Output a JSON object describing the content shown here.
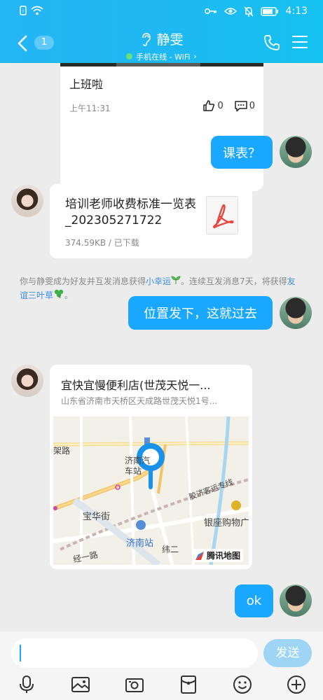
{
  "status_bar": {
    "time": "4:13"
  },
  "header": {
    "unread_count": "1",
    "contact_name": "静雯",
    "status": "手机在线 - WiFi",
    "status_chevron": "›"
  },
  "messages": {
    "post": {
      "text": "上班啦",
      "time": "上午11:31",
      "likes": "0",
      "comments": "0"
    },
    "msg1": {
      "text": "课表？"
    },
    "file": {
      "name": "培训老师收费标准一览表_202305271722",
      "meta": "374.59KB / 已下载"
    },
    "system": {
      "part1": "你与静雯成为好友并互发消息获得",
      "link1": "小幸运",
      "part2": "。连续互发消息7天，将获得",
      "link2": "友谊三叶草"
    },
    "msg2": {
      "text": "位置发下，这就过去"
    },
    "location": {
      "name": "宜快宜慢便利店(世茂天悦一...",
      "address": "山东省济南市天桥区天成路世茂天悦1号...",
      "map_labels": [
        "架路",
        "济南汽车站",
        "胶济客运专线",
        "宝华街",
        "银座购物广",
        "济南站",
        "纬二",
        "经一路"
      ],
      "map_brand": "腾讯地图"
    },
    "msg3": {
      "text": "ok"
    }
  },
  "input": {
    "value": "",
    "send_label": "发送"
  },
  "icons": [
    "wifi-icon",
    "key-icon",
    "eye-icon",
    "bell-off-icon",
    "battery-icon",
    "back-icon",
    "ear-icon",
    "phone-icon",
    "menu-icon",
    "thumbs-up-icon",
    "comment-icon",
    "pdf-icon",
    "sprout-icon",
    "clover-icon",
    "map-pin-icon",
    "mic-icon",
    "image-icon",
    "camera-icon",
    "red-packet-icon",
    "emoji-icon",
    "plus-icon"
  ],
  "colors": {
    "header": "#1fb8f2",
    "bubble": "#1aa7ff",
    "link": "#3a8de0",
    "send_disabled": "#9ed5f5"
  }
}
